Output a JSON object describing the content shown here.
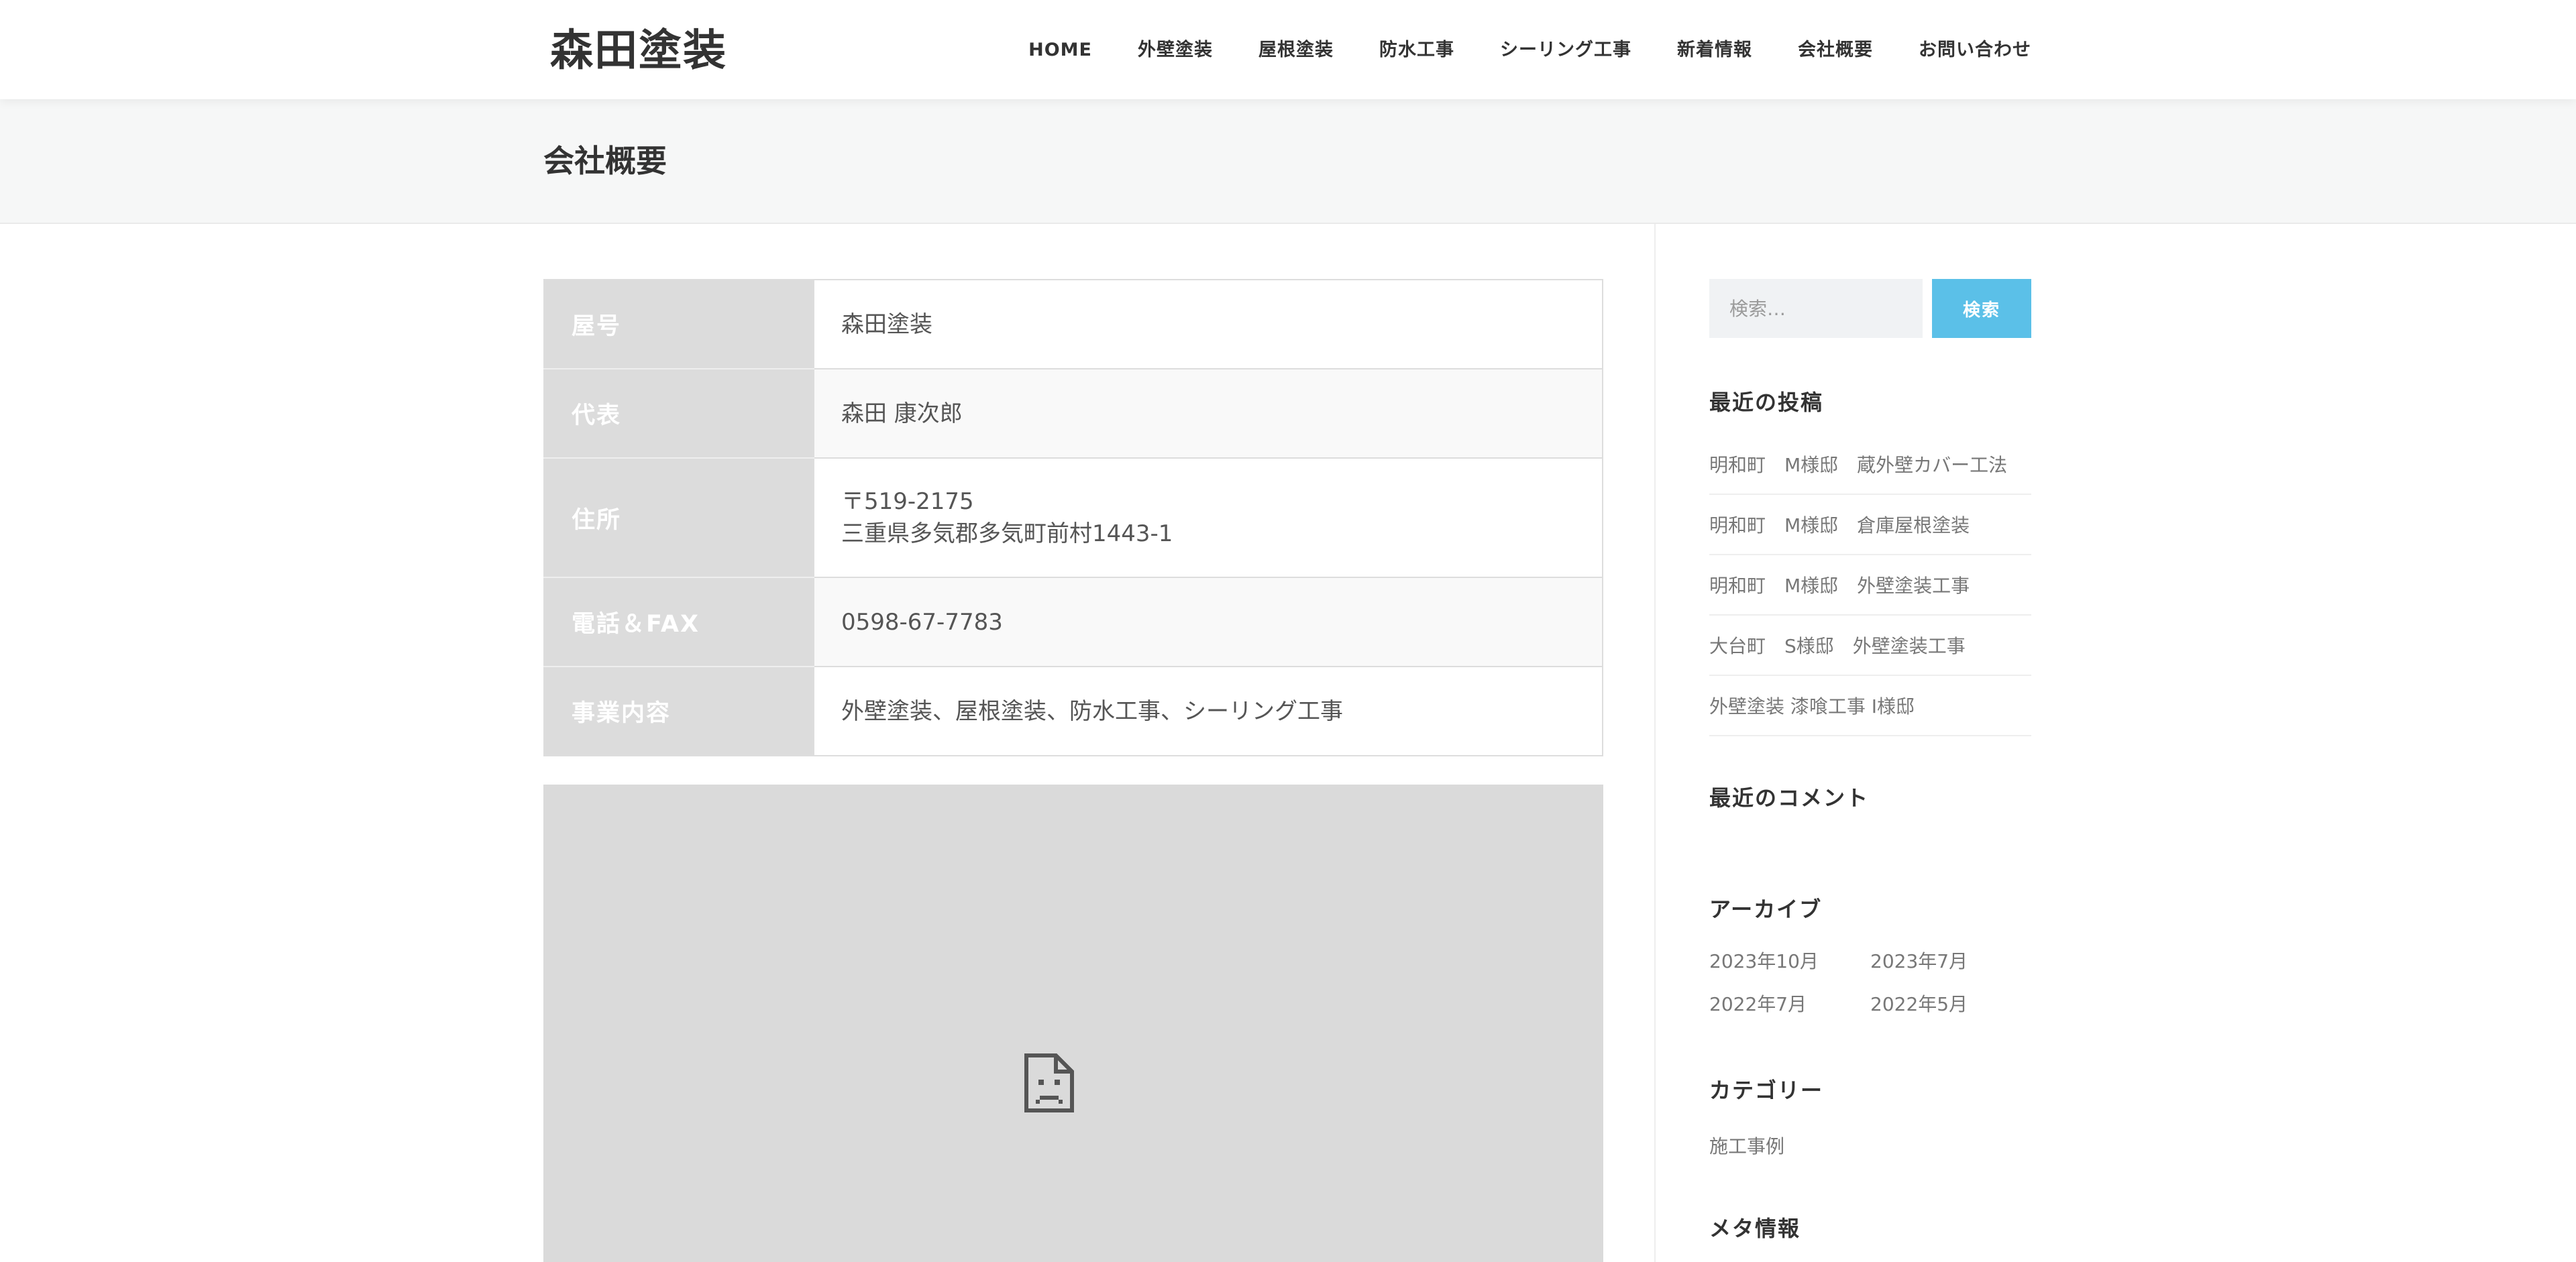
{
  "header": {
    "logo": "森田塗装",
    "nav": [
      {
        "label": "HOME"
      },
      {
        "label": "外壁塗装"
      },
      {
        "label": "屋根塗装"
      },
      {
        "label": "防水工事"
      },
      {
        "label": "シーリング工事"
      },
      {
        "label": "新着情報"
      },
      {
        "label": "会社概要"
      },
      {
        "label": "お問い合わせ"
      }
    ]
  },
  "page": {
    "title": "会社概要"
  },
  "company": {
    "rows": [
      {
        "label": "屋号",
        "value": "森田塗装"
      },
      {
        "label": "代表",
        "value": "森田 康次郎"
      },
      {
        "label": "住所",
        "value_line1": "〒519-2175",
        "value_line2": "三重県多気郡多気町前村1443-1"
      },
      {
        "label": "電話＆FAX",
        "value": "0598-67-7783"
      },
      {
        "label": "事業内容",
        "value": "外壁塗装、屋根塗装、防水工事、シーリング工事"
      }
    ]
  },
  "map": {
    "icon": "broken-page-icon"
  },
  "sidebar": {
    "search": {
      "placeholder": "検索…",
      "button_label": "検索"
    },
    "recent_posts": {
      "title": "最近の投稿",
      "items": [
        "明和町　M様邸　蔵外壁カバー工法",
        "明和町　M様邸　倉庫屋根塗装",
        "明和町　M様邸　外壁塗装工事",
        "大台町　S様邸　外壁塗装工事",
        "外壁塗装 漆喰工事 I様邸"
      ]
    },
    "recent_comments": {
      "title": "最近のコメント"
    },
    "archives": {
      "title": "アーカイブ",
      "items": [
        "2023年10月",
        "2023年7月",
        "2022年7月",
        "2022年5月"
      ]
    },
    "categories": {
      "title": "カテゴリー",
      "items": [
        "施工事例"
      ]
    },
    "meta": {
      "title": "メタ情報"
    }
  }
}
